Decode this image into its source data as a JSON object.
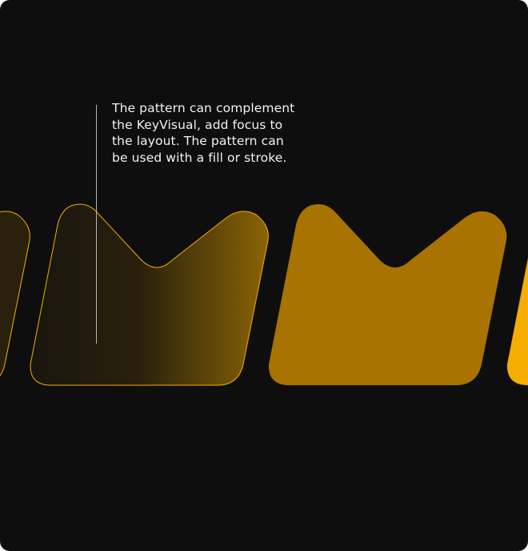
{
  "caption": {
    "lines": [
      "The pattern can complement",
      "the KeyVisual, add focus to",
      "the layout. The pattern can",
      "be used with a fill or stroke."
    ]
  },
  "colors": {
    "background": "#0e0e0e",
    "accent": "#f5ad00",
    "stroke": "#f5ad00",
    "text": "#f2f2f2",
    "line": "#b9b9b9"
  },
  "pattern": {
    "shape": "crown-icon",
    "variants": [
      "stroke",
      "fill"
    ]
  }
}
